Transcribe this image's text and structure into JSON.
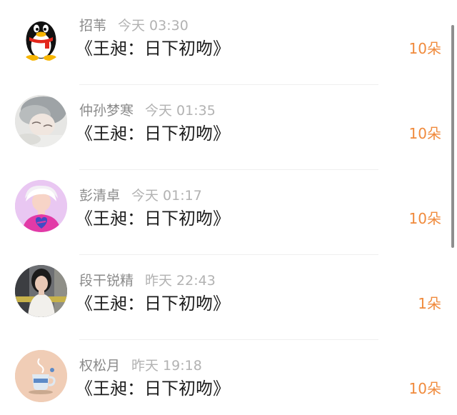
{
  "items": [
    {
      "name": "招苇",
      "time": "今天 03:30",
      "title": "《王昶：日下初吻》",
      "count": "10朵",
      "avatar": "qq-penguin-icon"
    },
    {
      "name": "仲孙梦寒",
      "time": "今天 01:35",
      "title": "《王昶：日下初吻》",
      "count": "10朵",
      "avatar": "sleeping-person-photo"
    },
    {
      "name": "彭清卓",
      "time": "今天 01:17",
      "title": "《王昶：日下初吻》",
      "count": "10朵",
      "avatar": "pink-cartoon-girl-illustration"
    },
    {
      "name": "段干锐精",
      "time": "昨天 22:43",
      "title": "《王昶：日下初吻》",
      "count": "1朵",
      "avatar": "girl-portrait-photo"
    },
    {
      "name": "权松月",
      "time": "昨天 19:18",
      "title": "《王昶：日下初吻》",
      "count": "10朵",
      "avatar": "coffee-cup-illustration"
    }
  ],
  "colors": {
    "name": "#8a8a8a",
    "time": "#b2b2b2",
    "title": "#1c1c1c",
    "count": "#f08a3c",
    "divider": "#efefef"
  }
}
